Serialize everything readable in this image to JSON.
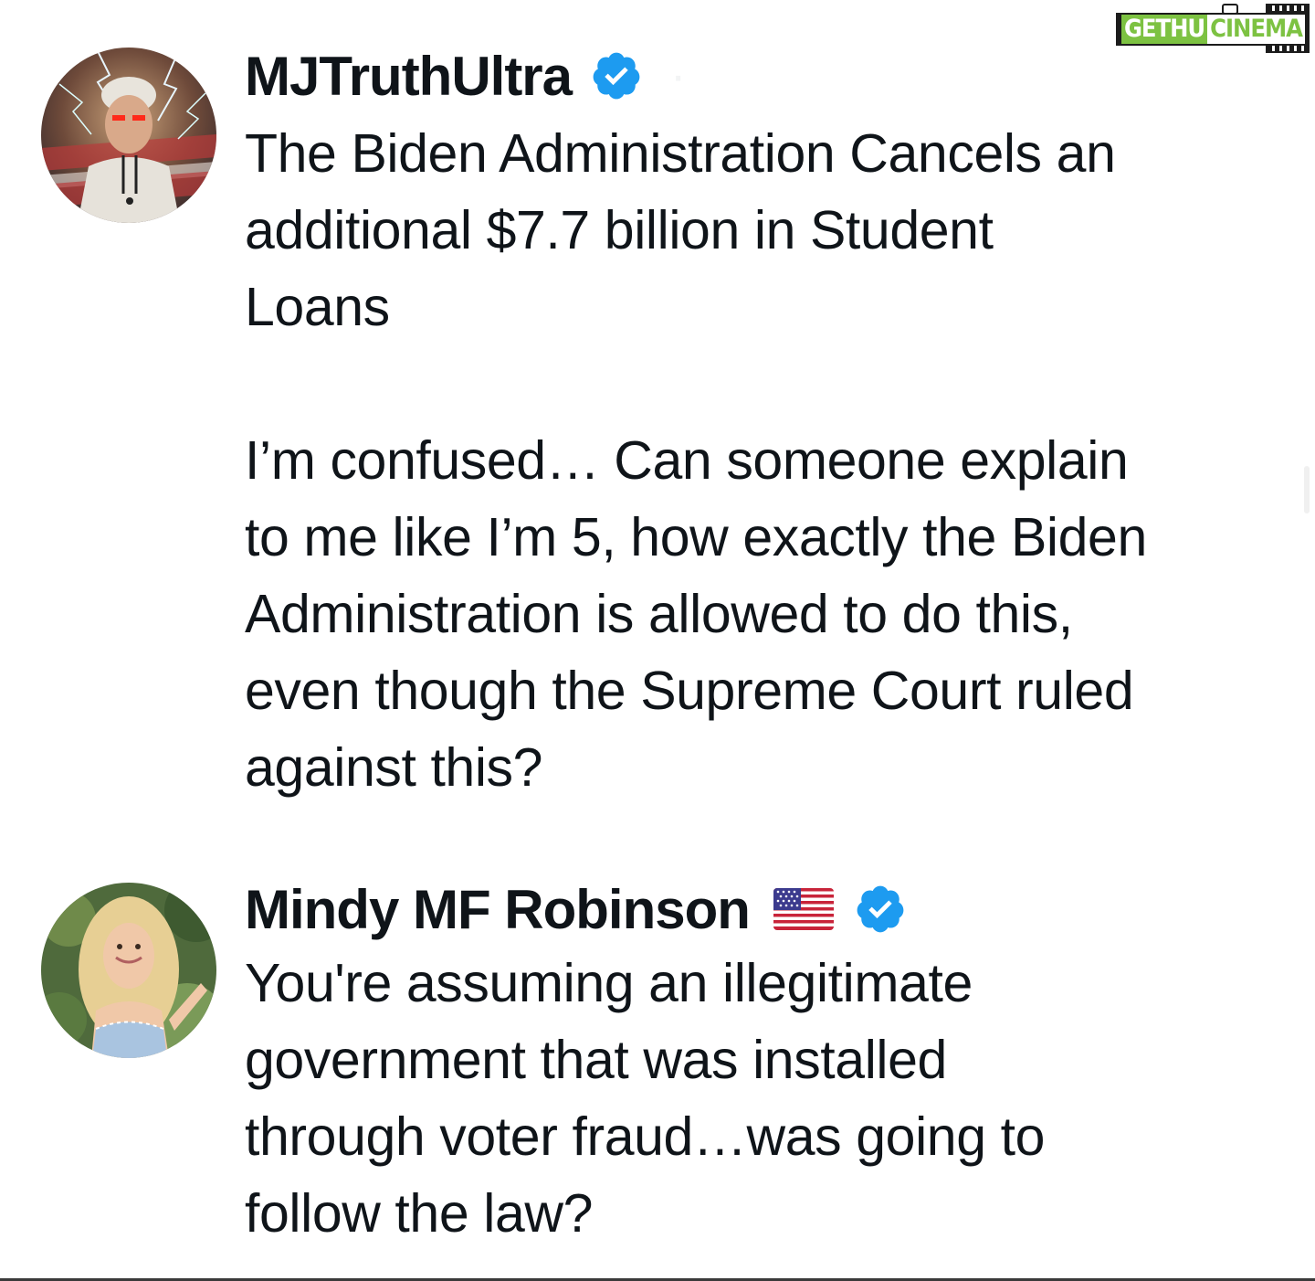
{
  "watermark": {
    "part1": "GETHU",
    "part2": "CINEMA",
    "icon": "camera-film-logo"
  },
  "tweets": [
    {
      "username": "MJTruthUltra",
      "verified": true,
      "verified_icon": "verified-badge-icon",
      "avatar_icon": "avatar-lightning-man",
      "flag": "",
      "text": "The Biden Administration Cancels an\nadditional $7.7 billion in Student\nLoans\n\nI’m confused… Can someone explain\nto me like I’m 5, how exactly the Biden\nAdministration is allowed to do this,\neven though the Supreme Court ruled\nagainst this?"
    },
    {
      "username": "Mindy MF Robinson",
      "verified": true,
      "verified_icon": "verified-badge-icon",
      "avatar_icon": "avatar-woman-curly-hair",
      "flag": "us-flag-emoji",
      "text": "You're assuming an illegitimate\ngovernment that was installed\nthrough voter fraud…was going to\nfollow the law?"
    }
  ],
  "colors": {
    "verified_blue": "#1d9bf0",
    "text": "#0f1419",
    "watermark_green": "#7dc242"
  }
}
